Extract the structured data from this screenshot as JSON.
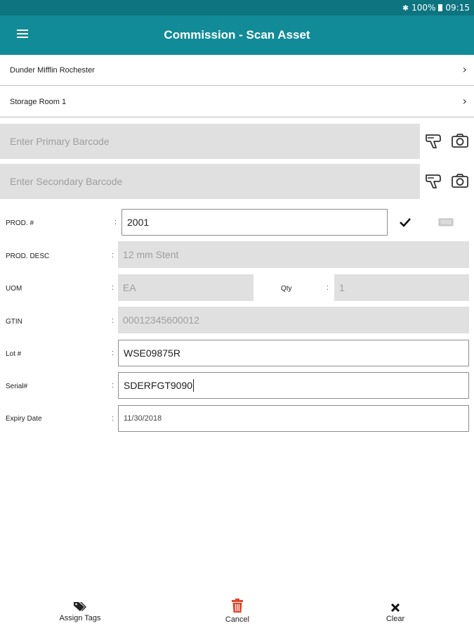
{
  "status_bar": {
    "battery": "100%",
    "time": "09:15",
    "icons": [
      "bluetooth-icon",
      "battery-icon"
    ]
  },
  "app_bar": {
    "title": "Commission - Scan Asset",
    "menu_icon": "menu-icon"
  },
  "location": {
    "site": "Dunder Mifflin Rochester",
    "room": "Storage Room 1"
  },
  "barcodes": {
    "primary_placeholder": "Enter Primary Barcode",
    "secondary_placeholder": "Enter Secondary Barcode",
    "icons": [
      "barcode-scanner-icon",
      "camera-icon"
    ]
  },
  "form": {
    "prod_no": {
      "label": "PROD. #",
      "value": "2001"
    },
    "prod_desc": {
      "label": "PROD. DESC",
      "value": "12 mm Stent"
    },
    "uom": {
      "label": "UOM",
      "value": "EA"
    },
    "qty": {
      "label": "Qty",
      "value": "1"
    },
    "gtin": {
      "label": "GTIN",
      "value": "00012345600012"
    },
    "lot": {
      "label": "Lot #",
      "value": "WSE09875R"
    },
    "serial": {
      "label": "Serial#",
      "value": "SDERFGT9090"
    },
    "expiry": {
      "label": "Expiry Date",
      "value": "11/30/2018"
    },
    "colon": ":"
  },
  "actions": {
    "assign_tags": "Assign Tags",
    "cancel": "Cancel",
    "clear": "Clear"
  },
  "colors": {
    "status_bar": "#0d7480",
    "app_bar": "#128b98",
    "cancel_icon": "#e2462e"
  }
}
